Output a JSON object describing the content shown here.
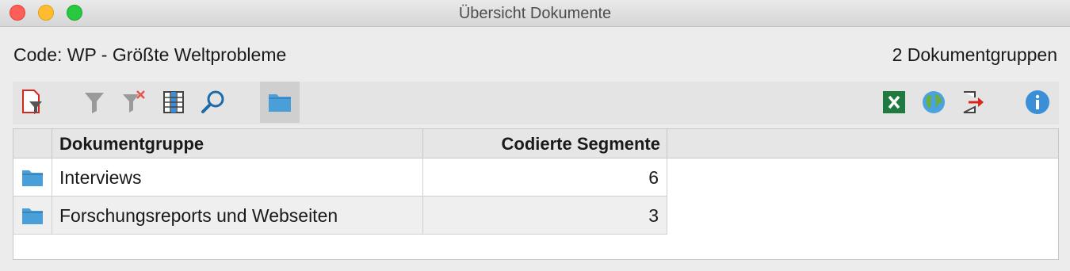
{
  "window": {
    "title": "Übersicht Dokumente"
  },
  "header": {
    "code_label": "Code: WP - Größte Weltprobleme",
    "group_count": "2 Dokumentgruppen"
  },
  "toolbar": {
    "left": [
      "filter-document-icon",
      "filter-icon",
      "clear-filter-icon",
      "columns-icon",
      "search-icon",
      "folder-icon"
    ],
    "right": [
      "excel-export-icon",
      "web-export-icon",
      "export-icon",
      "info-icon"
    ]
  },
  "table": {
    "columns": [
      "Dokumentgruppe",
      "Codierte Segmente"
    ],
    "rows": [
      {
        "name": "Interviews",
        "count": "6"
      },
      {
        "name": "Forschungsreports und Webseiten",
        "count": "3"
      }
    ]
  },
  "colors": {
    "folder_blue": "#4a9fd8",
    "excel_green": "#1f7a3f",
    "info_blue": "#3a8fd8",
    "export_red": "#d9261c"
  }
}
